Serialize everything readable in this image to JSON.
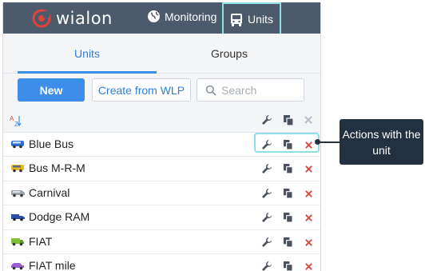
{
  "brand": {
    "name": "wialon"
  },
  "nav": {
    "monitoring": "Monitoring",
    "units": "Units"
  },
  "tabs": {
    "units": "Units",
    "groups": "Groups"
  },
  "toolbar": {
    "new_label": "New",
    "create_label": "Create from WLP",
    "search_placeholder": "Search"
  },
  "list_header": {
    "sort_label": "AZ"
  },
  "units": [
    {
      "name": "Blue Bus",
      "icon": "blue-bus-icon"
    },
    {
      "name": "Bus M-R-M",
      "icon": "yellow-bus-icon"
    },
    {
      "name": "Carnival",
      "icon": "grey-van-icon"
    },
    {
      "name": "Dodge RAM",
      "icon": "blue-truck-icon"
    },
    {
      "name": "FIAT",
      "icon": "green-truck-icon"
    },
    {
      "name": "FIAT mile",
      "icon": "purple-car-icon"
    }
  ],
  "callout": {
    "text": "Actions with the unit"
  },
  "colors": {
    "topbar": "#4d5a6c",
    "accent": "#3d8ee8",
    "highlight": "#8fe0e6",
    "delete": "#e0463c",
    "callout": "#23303f"
  }
}
